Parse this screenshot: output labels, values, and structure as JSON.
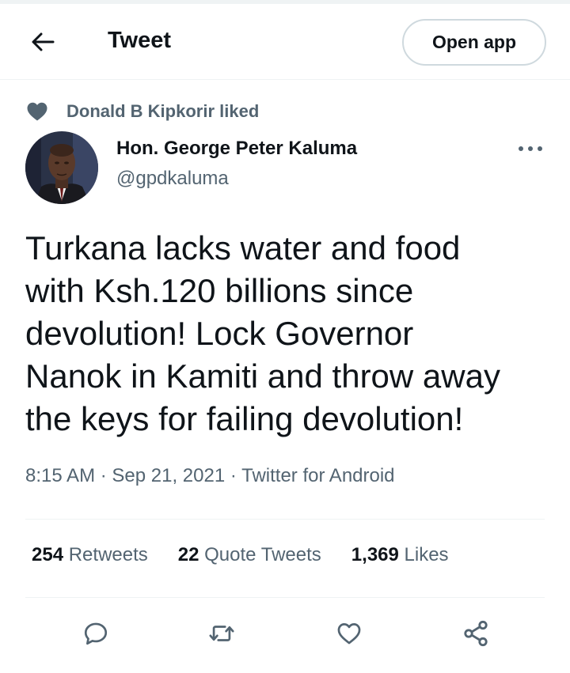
{
  "header": {
    "title": "Tweet",
    "open_app_label": "Open app",
    "back_icon": "arrow-left-icon"
  },
  "social_context": {
    "text": "Donald B Kipkorir liked",
    "icon": "heart-filled-icon"
  },
  "tweet": {
    "author_name": "Hon. George Peter Kaluma",
    "author_handle": "@gpdkaluma",
    "text_lines": [
      "Turkana lacks water and food",
      "with Ksh.120 billions since",
      "devolution! Lock Governor",
      "Nanok in Kamiti and throw away",
      "the keys for failing devolution!"
    ],
    "time": "8:15 AM",
    "date": "Sep 21, 2021",
    "separator": "·",
    "source": "Twitter for Android"
  },
  "stats": {
    "retweets_count": "254",
    "retweets_label": "Retweets",
    "quotes_count": "22",
    "quotes_label": "Quote Tweets",
    "likes_count": "1,369",
    "likes_label": "Likes"
  },
  "actions": [
    "reply-icon",
    "retweet-icon",
    "like-icon",
    "share-icon"
  ],
  "colors": {
    "text_primary": "#0f1419",
    "text_secondary": "#536471",
    "border": "#eff3f4",
    "button_border": "#cfd9de"
  }
}
